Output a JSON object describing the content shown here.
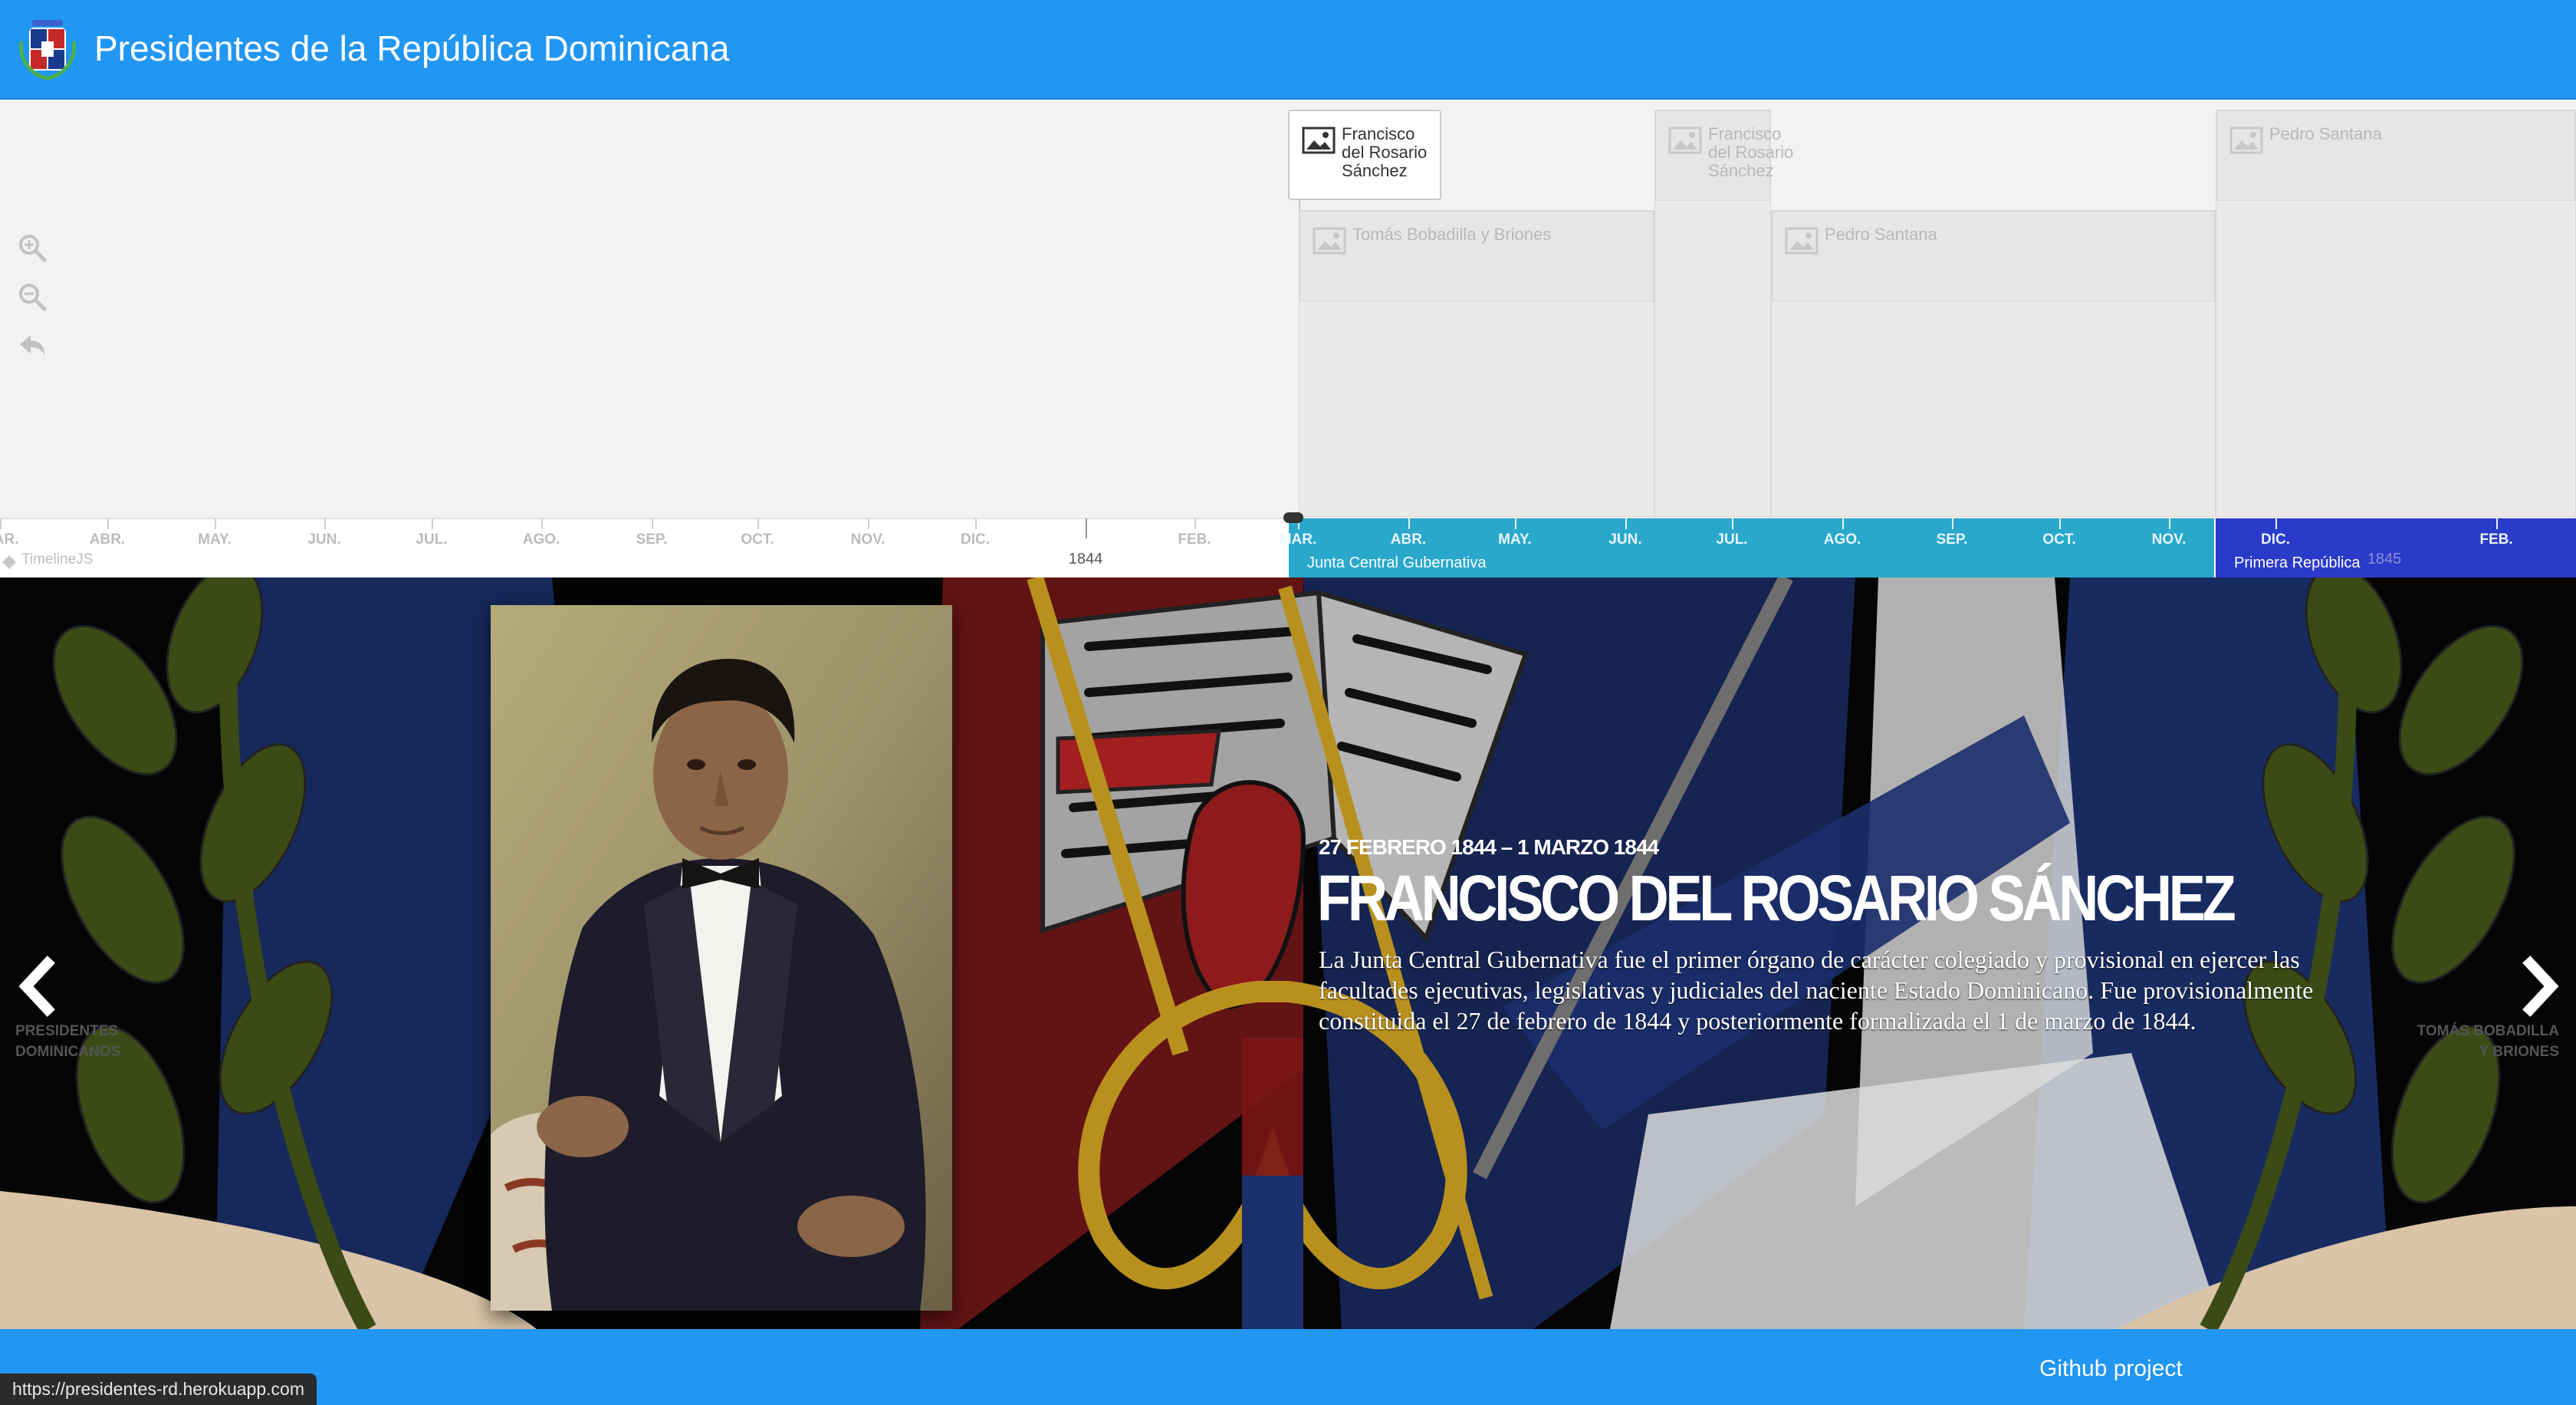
{
  "header": {
    "title": "Presidentes de la República Dominicana",
    "logo_icon": "dominican-coat-of-arms-icon",
    "bg_color": "#2196f3"
  },
  "timenav": {
    "zoom_in_icon": "zoom-in-icon",
    "zoom_out_icon": "zoom-out-icon",
    "back_icon": "back-to-start-icon",
    "markers": [
      {
        "lines": [
          "Francisco",
          "del Rosario",
          "Sánchez"
        ],
        "active": true
      },
      {
        "lines": [
          "Tomás Bobadilla y Briones"
        ],
        "active": false
      },
      {
        "lines": [
          "Francisco",
          "del Rosario",
          "Sánchez"
        ],
        "active": false
      },
      {
        "lines": [
          "Pedro Santana"
        ],
        "active": false
      },
      {
        "lines": [
          "Pedro Santana"
        ],
        "active": false
      }
    ],
    "months": [
      "AR.",
      "ABR.",
      "MAY.",
      "JUN.",
      "JUL.",
      "AGO.",
      "SEP.",
      "OCT.",
      "NOV.",
      "DIC.",
      "FEB.",
      "MAR.",
      "ABR.",
      "MAY.",
      "JUN.",
      "JUL.",
      "AGO.",
      "SEP.",
      "OCT.",
      "NOV.",
      "DIC.",
      "FEB."
    ],
    "years": [
      "1844",
      "1845"
    ],
    "eras": [
      {
        "label": "Junta Central Gubernativa",
        "color": "#29a8cc"
      },
      {
        "label": "Primera República",
        "color": "#2a3ac9"
      }
    ],
    "credit": "TimelineJS"
  },
  "slide": {
    "date": "27 FEBRERO 1844 – 1 MARZO 1844",
    "title": "FRANCISCO DEL ROSARIO SÁNCHEZ",
    "text": "La Junta Central Gubernativa fue el primer órgano de carácter colegiado y provisional en ejercer las facultades ejecutivas, legislativas y judiciales del naciente Estado Dominicano. Fue provisionalmente constituida el 27 de febrero de 1844 y posteriormente formalizada el 1 de marzo de 1844.",
    "image_icon": "portrait-francisco-del-rosario-sanchez",
    "prev": {
      "icon": "chevron-left-icon",
      "lines": [
        "PRESIDENTES",
        "DOMINICANOS"
      ]
    },
    "next": {
      "icon": "chevron-right-icon",
      "lines": [
        "TOMÁS BOBADILLA",
        "Y BRIONES"
      ]
    }
  },
  "footer": {
    "link_label": "Github project",
    "status_url": "https://presidentes-rd.herokuapp.com"
  }
}
